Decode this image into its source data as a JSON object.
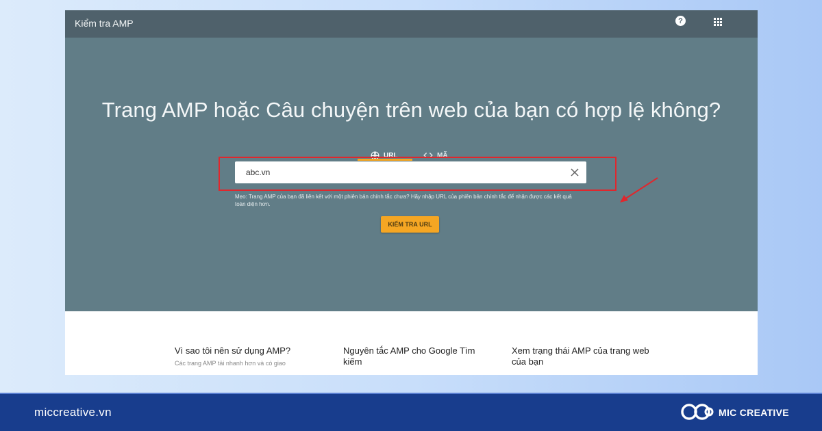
{
  "app": {
    "title": "Kiểm tra AMP",
    "help_icon": "help-icon",
    "apps_icon": "apps-grid-icon"
  },
  "hero": {
    "headline": "Trang AMP hoặc Câu chuyện trên web của bạn có hợp lệ không?",
    "tabs": [
      {
        "label": "URL",
        "icon": "globe-icon",
        "selected": true
      },
      {
        "label": "MÃ",
        "icon": "code-icon",
        "selected": false
      }
    ],
    "url_input": {
      "value": "abc.vn",
      "placeholder": ""
    },
    "hint": "Mẹo: Trang AMP của bạn đã liên kết với một phiên bản chính tắc chưa? Hãy nhập URL của phiên bản chính tắc để nhận được các kết quả toàn diện hơn.",
    "button_label": "KIỂM TRA URL"
  },
  "info_columns": [
    {
      "title": "Vì sao tôi nên sử dụng AMP?",
      "subtitle": "Các trang AMP tải nhanh hơn và có giao"
    },
    {
      "title": "Nguyên tắc AMP cho Google Tìm kiếm",
      "subtitle": ""
    },
    {
      "title": "Xem trạng thái AMP của trang web của bạn",
      "subtitle": ""
    }
  ],
  "footer": {
    "website": "miccreative.vn",
    "brand": "MIC CREATIVE"
  },
  "colors": {
    "topbar": "#4f616b",
    "hero": "#617d87",
    "accent": "#f5a623",
    "highlight": "#e0272d",
    "footer": "#183d8d"
  }
}
